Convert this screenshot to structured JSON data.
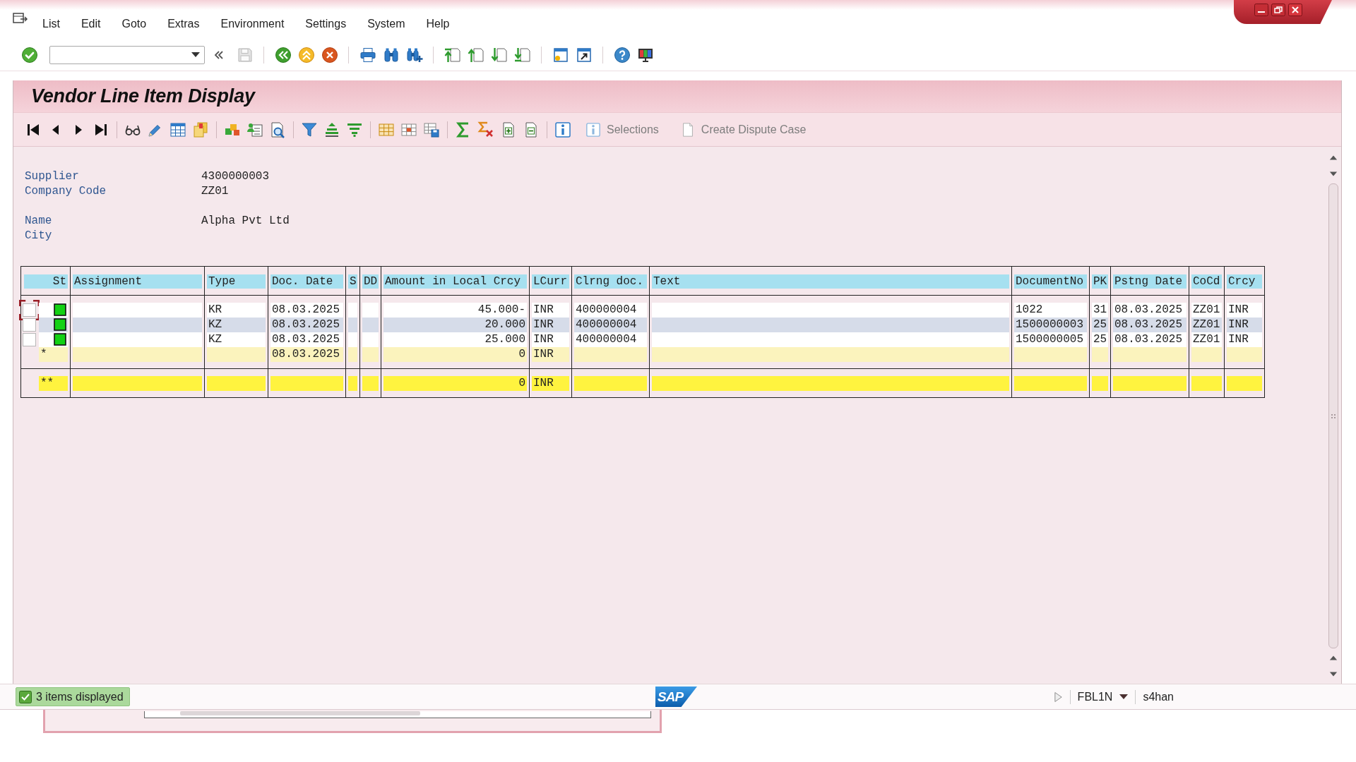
{
  "menu_bar": {
    "items": [
      "List",
      "Edit",
      "Goto",
      "Extras",
      "Environment",
      "Settings",
      "System",
      "Help"
    ]
  },
  "window": {
    "title": "Vendor Line Item Display"
  },
  "app_toolbar": {
    "buttons": [
      {
        "label": "Selections"
      },
      {
        "label": "Create Dispute Case"
      }
    ]
  },
  "header_fields": [
    [
      {
        "label": "Supplier",
        "value": "4300000003"
      },
      {
        "label": "Company Code",
        "value": "ZZ01"
      }
    ],
    [
      {
        "label": "Name",
        "value": "Alpha Pvt Ltd"
      },
      {
        "label": "City"
      }
    ]
  ],
  "table": {
    "columns": [
      {
        "label": "St"
      },
      {
        "label": "Assignment"
      },
      {
        "label": "Type"
      },
      {
        "label": "Doc. Date"
      },
      {
        "label": "S"
      },
      {
        "label": "DD"
      },
      {
        "label": "Amount in Local Crcy"
      },
      {
        "label": "LCurr"
      },
      {
        "label": "Clrng doc."
      },
      {
        "label": "Text"
      },
      {
        "label": "DocumentNo"
      },
      {
        "label": "PK"
      },
      {
        "label": "Pstng Date"
      },
      {
        "label": "CoCd"
      },
      {
        "label": "Crcy"
      }
    ],
    "rows": [
      {
        "kind": "item",
        "selected": false,
        "focused": true,
        "cleared": true,
        "type": "KR",
        "doc_date": "08.03.2025",
        "amount": "45.000-",
        "lcurr": "INR",
        "clrng_doc": "400000004",
        "document_no": "1022",
        "pk": "31",
        "pstng_date": "08.03.2025",
        "cocd": "ZZ01",
        "crcy": "INR"
      },
      {
        "kind": "item",
        "selected": false,
        "focused": false,
        "cleared": true,
        "type": "KZ",
        "doc_date": "08.03.2025",
        "amount": "20.000",
        "lcurr": "INR",
        "clrng_doc": "400000004",
        "document_no": "1500000003",
        "pk": "25",
        "pstng_date": "08.03.2025",
        "cocd": "ZZ01",
        "crcy": "INR"
      },
      {
        "kind": "item",
        "selected": false,
        "focused": false,
        "cleared": true,
        "type": "KZ",
        "doc_date": "08.03.2025",
        "amount": "25.000",
        "lcurr": "INR",
        "clrng_doc": "400000004",
        "document_no": "1500000005",
        "pk": "25",
        "pstng_date": "08.03.2025",
        "cocd": "ZZ01",
        "crcy": "INR"
      },
      {
        "kind": "subtotal",
        "marker": "*",
        "doc_date": "08.03.2025",
        "amount": "0",
        "lcurr": "INR"
      },
      {
        "kind": "total",
        "marker": "**",
        "amount": "0",
        "lcurr": "INR"
      }
    ]
  },
  "status_bar": {
    "message": {
      "kind": "success",
      "text": "3 items displayed"
    },
    "logo": "SAP",
    "transaction": "FBL1N",
    "system": "s4han"
  }
}
